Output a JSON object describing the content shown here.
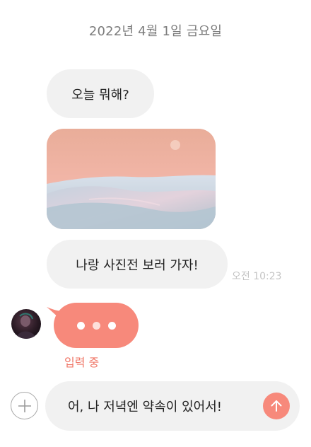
{
  "chat": {
    "date_header": "2022년 4월 1일 금요일",
    "messages": [
      {
        "text": "오늘 뭐해?"
      },
      {
        "text": "나랑 사진전 보러 가자!"
      }
    ],
    "photo_icon": "desert-landscape-image",
    "timestamp": "오전 10:23",
    "typing_indicator_label": "입력 중"
  },
  "composer": {
    "text": "어, 나 저녁엔 약속이 있어서!",
    "plus_icon": "plus-icon",
    "send_icon": "arrow-up-icon"
  },
  "colors": {
    "accent": "#f7897b",
    "bubble_bg": "#f1f1f1",
    "muted_text": "#7c7c7c",
    "typing_label": "#f0796a"
  }
}
